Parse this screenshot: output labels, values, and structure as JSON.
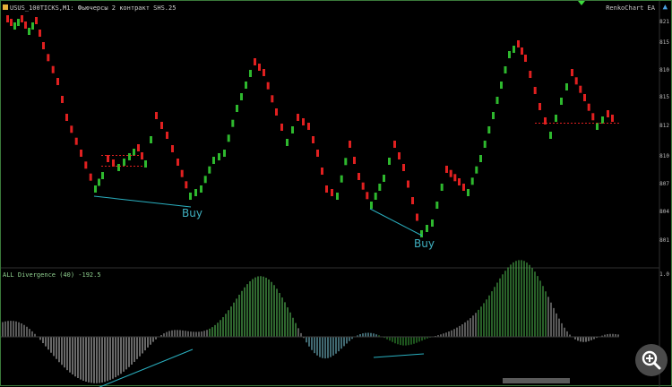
{
  "header": {
    "symbol_line": "USUS_100TICKS,M1: Фьючерсы 2 контракт SHS.25",
    "ea_label": "RenkoChart EA"
  },
  "price_axis": [
    "821",
    "815",
    "810",
    "815",
    "812",
    "810",
    "807",
    "804",
    "801"
  ],
  "annotations": [
    "Buy",
    "Buy"
  ],
  "indicator": {
    "title": "ALL Divergence (40) -192.5",
    "scale_label": "1.0"
  },
  "colors": {
    "bull": "#2eb82e",
    "bear": "#e02020",
    "divergence_line": "#2ab0c0",
    "frame": "#3a7a3a"
  },
  "icons": [
    "zoom-in-icon",
    "magnifier-icon",
    "triangle-marker-icon"
  ]
}
